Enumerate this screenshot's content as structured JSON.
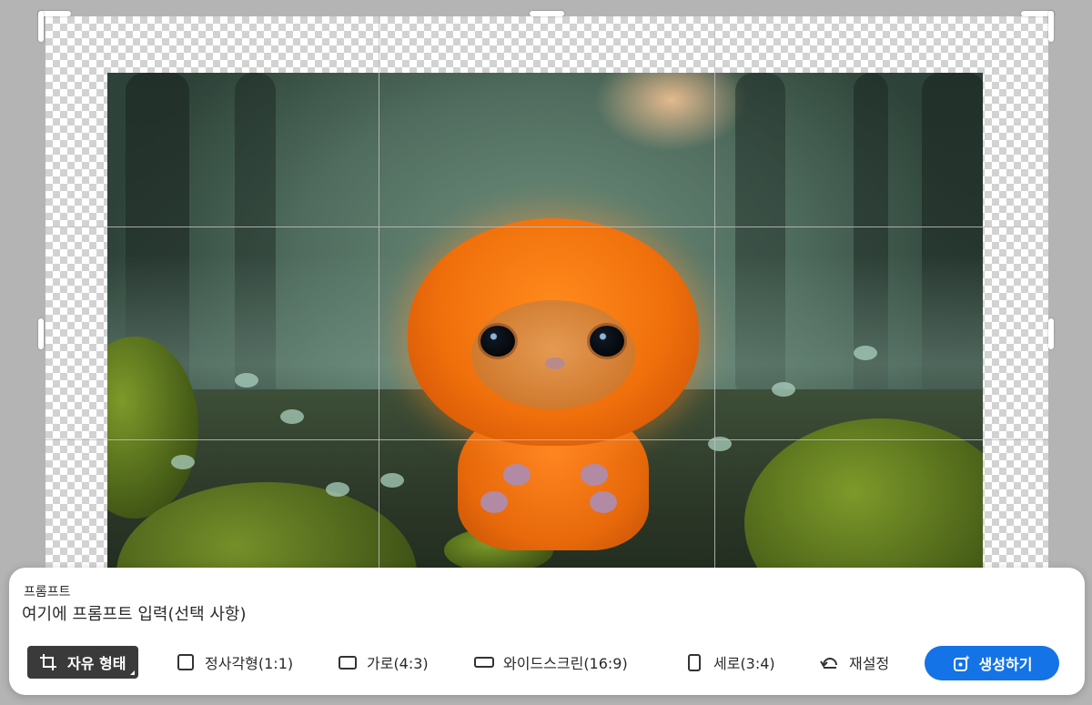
{
  "prompt": {
    "label": "프롬프트",
    "placeholder": "여기에 프롬프트 입력(선택 사항)"
  },
  "crop_options": [
    {
      "label": "자유 형태",
      "icon": "crop-icon",
      "active": true
    },
    {
      "label": "정사각형(1:1)",
      "icon": "square-icon",
      "active": false
    },
    {
      "label": "가로(4:3)",
      "icon": "landscape-icon",
      "active": false
    },
    {
      "label": "와이드스크린(16:9)",
      "icon": "widescreen-icon",
      "active": false
    },
    {
      "label": "세로(3:4)",
      "icon": "portrait-icon",
      "active": false
    },
    {
      "label": "재설정",
      "icon": "reset-icon",
      "active": false
    }
  ],
  "generate_button": {
    "label": "생성하기",
    "icon": "generate-icon"
  },
  "colors": {
    "accent": "#1473e6",
    "active_option_bg": "#3a3a3a"
  }
}
